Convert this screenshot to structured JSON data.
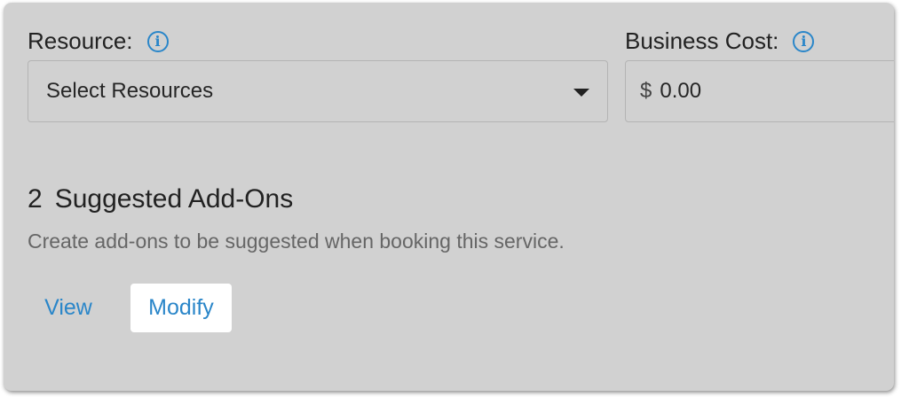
{
  "resource": {
    "label": "Resource:",
    "info_icon": "info-icon",
    "select_value": "Select Resources",
    "dropdown_icon": "caret-down-icon"
  },
  "business_cost": {
    "label": "Business Cost:",
    "info_icon": "info-icon",
    "currency_symbol": "$",
    "value": "0.00"
  },
  "addons": {
    "count": "2",
    "title": "Suggested Add-Ons",
    "description": "Create add-ons to be suggested when booking this service.",
    "view_label": "View",
    "modify_label": "Modify"
  },
  "colors": {
    "panel_bg": "#d1d1d1",
    "accent": "#2a86c9",
    "highlight_bg": "#ffffff"
  }
}
